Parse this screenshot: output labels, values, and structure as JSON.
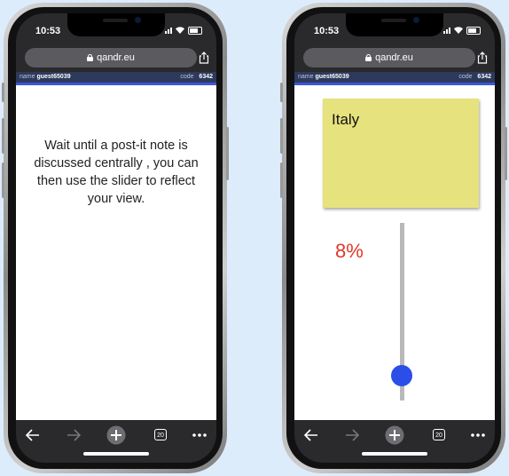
{
  "phones": [
    {
      "status": {
        "time": "10:53"
      },
      "browser": {
        "url": "qandr.eu"
      },
      "session": {
        "name_label": "name",
        "name_value": "guest65039",
        "code_label": "code",
        "code_value": "6342"
      },
      "message": "Wait until a post-it note is discussed centrally , you can then use the slider to reflect your view.",
      "toolbar": {
        "tabs_count": "20"
      }
    },
    {
      "status": {
        "time": "10:53"
      },
      "browser": {
        "url": "qandr.eu"
      },
      "session": {
        "name_label": "name",
        "name_value": "guest65039",
        "code_label": "code",
        "code_value": "6342"
      },
      "postit": {
        "text": "Italy",
        "color": "#e6e27e"
      },
      "slider": {
        "percent_label": "8%",
        "value_fraction": 0.08,
        "thumb_color": "#2b4de8",
        "percent_color": "#e0372a"
      },
      "toolbar": {
        "tabs_count": "20"
      }
    }
  ],
  "icons": [
    "lock-icon",
    "share-icon",
    "back-arrow-icon",
    "forward-arrow-icon",
    "new-tab-plus-icon",
    "tabs-icon",
    "more-menu-icon"
  ]
}
